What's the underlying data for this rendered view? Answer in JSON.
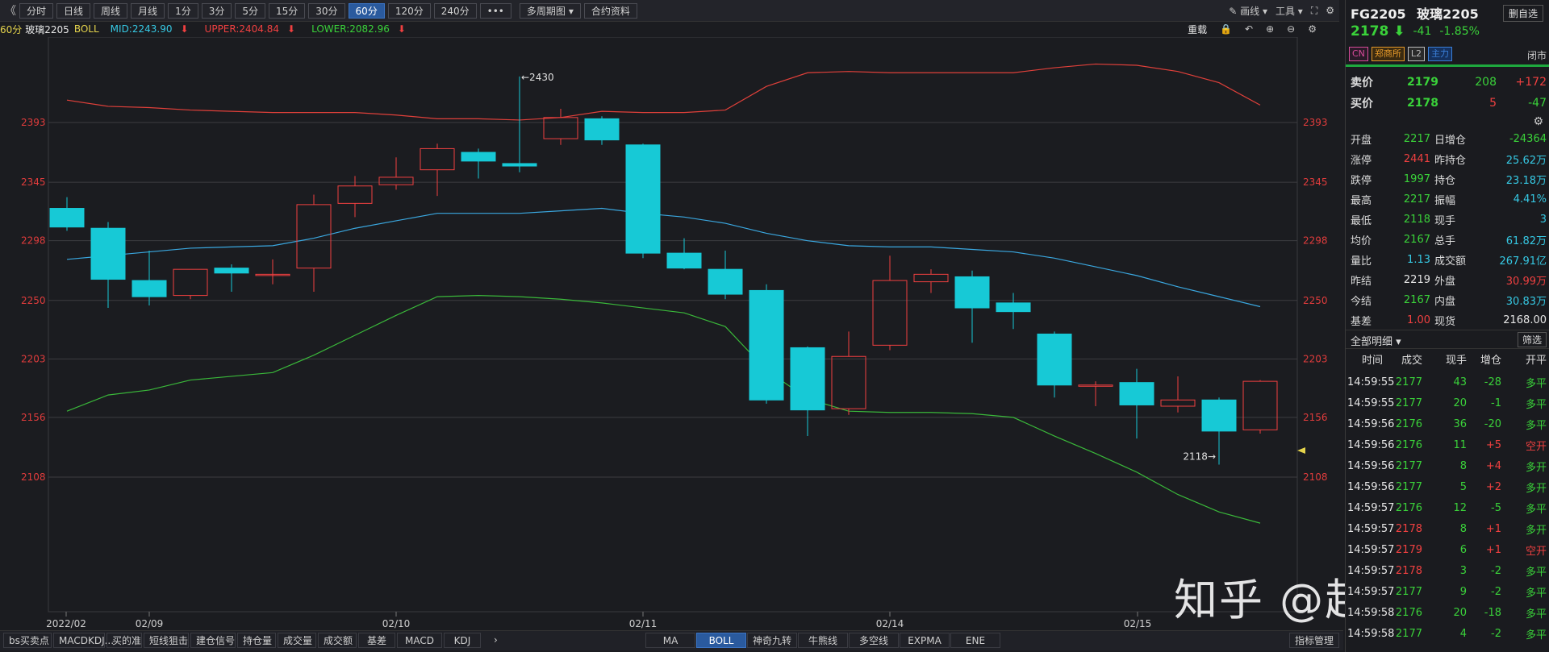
{
  "toolbar": {
    "back_glyph": "《",
    "buttons": [
      "分时",
      "日线",
      "周线",
      "月线",
      "1分",
      "3分",
      "5分",
      "15分",
      "30分",
      "60分",
      "120分",
      "240分",
      "•••",
      "多周期图",
      "合约资料"
    ],
    "active_index": 9,
    "multi_period_arrow": "▾",
    "draw_label": "画线",
    "tools_label": "工具"
  },
  "indicator_bar": {
    "period": "60分",
    "symbol": "玻璃2205",
    "indicator": "BOLL",
    "mid": "MID:2243.90",
    "upper": "UPPER:2404.84",
    "lower": "LOWER:2082.96",
    "reweight": "重载"
  },
  "colors": {
    "bg": "#1b1c20",
    "up": "#f04040",
    "down": "#17c9d6",
    "mid_line": "#3aa7df",
    "upper_line": "#e0403a",
    "lower_line": "#3ab83a",
    "grid": "#3c3c40",
    "axis_text": "#e13c3c"
  },
  "chart_data": {
    "type": "candlestick",
    "y_ticks": [
      2393,
      2345,
      2298,
      2250,
      2203,
      2156,
      2108
    ],
    "x_labels": [
      "2022/02",
      "02/09",
      "02/10",
      "02/11",
      "02/14",
      "02/15"
    ],
    "annotations": {
      "high": "←2430",
      "low": "2118→"
    },
    "candles": [
      {
        "o": 2324,
        "h": 2333,
        "l": 2306,
        "c": 2309
      },
      {
        "o": 2308,
        "h": 2313,
        "l": 2244,
        "c": 2267
      },
      {
        "o": 2266,
        "h": 2290,
        "l": 2246,
        "c": 2253
      },
      {
        "o": 2254,
        "h": 2275,
        "l": 2251,
        "c": 2275
      },
      {
        "o": 2276,
        "h": 2279,
        "l": 2257,
        "c": 2272
      },
      {
        "o": 2271,
        "h": 2283,
        "l": 2263,
        "c": 2271
      },
      {
        "o": 2276,
        "h": 2335,
        "l": 2257,
        "c": 2327
      },
      {
        "o": 2328,
        "h": 2350,
        "l": 2317,
        "c": 2342
      },
      {
        "o": 2343,
        "h": 2365,
        "l": 2339,
        "c": 2349
      },
      {
        "o": 2355,
        "h": 2376,
        "l": 2334,
        "c": 2372
      },
      {
        "o": 2369,
        "h": 2372,
        "l": 2348,
        "c": 2362
      },
      {
        "o": 2360,
        "h": 2430,
        "l": 2353,
        "c": 2358
      },
      {
        "o": 2380,
        "h": 2404,
        "l": 2375,
        "c": 2397
      },
      {
        "o": 2396,
        "h": 2398,
        "l": 2375,
        "c": 2379
      },
      {
        "o": 2375,
        "h": 2376,
        "l": 2284,
        "c": 2288
      },
      {
        "o": 2288,
        "h": 2300,
        "l": 2275,
        "c": 2276
      },
      {
        "o": 2275,
        "h": 2290,
        "l": 2251,
        "c": 2255
      },
      {
        "o": 2258,
        "h": 2263,
        "l": 2167,
        "c": 2170
      },
      {
        "o": 2212,
        "h": 2213,
        "l": 2141,
        "c": 2162
      },
      {
        "o": 2163,
        "h": 2225,
        "l": 2158,
        "c": 2205
      },
      {
        "o": 2214,
        "h": 2286,
        "l": 2210,
        "c": 2266
      },
      {
        "o": 2265,
        "h": 2275,
        "l": 2256,
        "c": 2271
      },
      {
        "o": 2269,
        "h": 2274,
        "l": 2216,
        "c": 2244
      },
      {
        "o": 2248,
        "h": 2256,
        "l": 2227,
        "c": 2241
      },
      {
        "o": 2223,
        "h": 2225,
        "l": 2172,
        "c": 2182
      },
      {
        "o": 2181,
        "h": 2185,
        "l": 2165,
        "c": 2182
      },
      {
        "o": 2184,
        "h": 2195,
        "l": 2139,
        "c": 2166
      },
      {
        "o": 2165,
        "h": 2189,
        "l": 2160,
        "c": 2170
      },
      {
        "o": 2170,
        "h": 2172,
        "l": 2118,
        "c": 2145
      },
      {
        "o": 2146,
        "h": 2186,
        "l": 2143,
        "c": 2185
      }
    ],
    "upper": [
      2411,
      2406,
      2405,
      2403,
      2402,
      2401,
      2401,
      2401,
      2399,
      2396,
      2396,
      2395,
      2397,
      2402,
      2401,
      2401,
      2403,
      2422,
      2433,
      2434,
      2433,
      2433,
      2433,
      2433,
      2437,
      2440,
      2439,
      2434,
      2425,
      2407
    ],
    "mid": [
      2283,
      2286,
      2289,
      2292,
      2293,
      2294,
      2300,
      2308,
      2314,
      2320,
      2320,
      2320,
      2322,
      2324,
      2320,
      2317,
      2312,
      2304,
      2298,
      2294,
      2293,
      2293,
      2291,
      2289,
      2284,
      2277,
      2270,
      2261,
      2253,
      2245
    ],
    "lower": [
      2161,
      2174,
      2178,
      2186,
      2189,
      2192,
      2206,
      2222,
      2238,
      2253,
      2254,
      2253,
      2251,
      2248,
      2244,
      2240,
      2229,
      2194,
      2171,
      2161,
      2160,
      2160,
      2159,
      2156,
      2141,
      2127,
      2112,
      2094,
      2080,
      2071
    ]
  },
  "bottom_left_tabs": [
    "bs买卖点",
    "MACDKDJ...",
    "买的准",
    "短线狙击",
    "建仓信号",
    "持仓量",
    "成交量",
    "成交额",
    "基差",
    "MACD",
    "KDJ"
  ],
  "bottom_more": "›",
  "bottom_mid_tabs": [
    "MA",
    "BOLL",
    "神奇九转",
    "牛熊线",
    "多空线",
    "EXPMA",
    "ENE"
  ],
  "bottom_mid_active": 1,
  "bottom_right": "指标管理",
  "sidebar": {
    "code": "FG2205",
    "name": "玻璃2205",
    "remove_btn": "删自选",
    "price": "2178",
    "price_arrow": "⬇",
    "change": "-41",
    "change_pct": "-1.85%",
    "tags": [
      "CN",
      "郑商所",
      "L2",
      "主力"
    ],
    "status": "闭市",
    "sell": {
      "label": "卖价",
      "price": "2179",
      "vol": "208",
      "chg": "+172"
    },
    "buy": {
      "label": "买价",
      "price": "2178",
      "vol": "5",
      "chg": "-47"
    },
    "stats_left": [
      {
        "label": "开盘",
        "value": "2217"
      },
      {
        "label": "涨停",
        "value": "2441"
      },
      {
        "label": "跌停",
        "value": "1997"
      },
      {
        "label": "最高",
        "value": "2217"
      },
      {
        "label": "最低",
        "value": "2118"
      },
      {
        "label": "均价",
        "value": "2167"
      },
      {
        "label": "量比",
        "value": "1.13"
      },
      {
        "label": "昨结",
        "value": "2219"
      },
      {
        "label": "今结",
        "value": "2167"
      },
      {
        "label": "基差",
        "value": "1.00"
      }
    ],
    "stats_right": [
      {
        "label": "日增仓",
        "value": "-24364"
      },
      {
        "label": "昨持仓",
        "value": "25.62万"
      },
      {
        "label": "持仓",
        "value": "23.18万"
      },
      {
        "label": "振幅",
        "value": "4.41%"
      },
      {
        "label": "现手",
        "value": "3"
      },
      {
        "label": "总手",
        "value": "61.82万"
      },
      {
        "label": "成交额",
        "value": "267.91亿"
      },
      {
        "label": "外盘",
        "value": "30.99万"
      },
      {
        "label": "内盘",
        "value": "30.83万"
      },
      {
        "label": "现货",
        "value": "2168.00"
      }
    ],
    "detail_select": "全部明细",
    "filter_btn": "筛选",
    "trade_headers": [
      "时间",
      "成交",
      "现手",
      "增仓",
      "开平"
    ],
    "trades": [
      [
        "14:59:55",
        "2177",
        "43",
        "-28",
        "多平"
      ],
      [
        "14:59:55",
        "2177",
        "20",
        "-1",
        "多平"
      ],
      [
        "14:59:56",
        "2176",
        "36",
        "-20",
        "多平"
      ],
      [
        "14:59:56",
        "2176",
        "11",
        "+5",
        "空开"
      ],
      [
        "14:59:56",
        "2177",
        "8",
        "+4",
        "多开"
      ],
      [
        "14:59:56",
        "2177",
        "5",
        "+2",
        "多开"
      ],
      [
        "14:59:57",
        "2176",
        "12",
        "-5",
        "多平"
      ],
      [
        "14:59:57",
        "2178",
        "8",
        "+1",
        "多开"
      ],
      [
        "14:59:57",
        "2179",
        "6",
        "+1",
        "空开"
      ],
      [
        "14:59:57",
        "2178",
        "3",
        "-2",
        "多平"
      ],
      [
        "14:59:57",
        "2177",
        "9",
        "-2",
        "多平"
      ],
      [
        "14:59:58",
        "2176",
        "20",
        "-18",
        "多平"
      ],
      [
        "14:59:58",
        "2177",
        "4",
        "-2",
        "多平"
      ]
    ]
  },
  "watermark": "知乎 @超期阅评"
}
